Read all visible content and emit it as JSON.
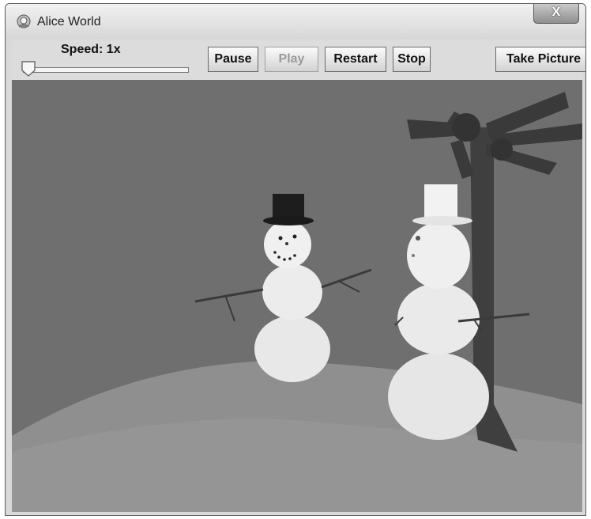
{
  "window": {
    "title": "Alice World",
    "close_symbol": "X"
  },
  "toolbar": {
    "speed_label": "Speed: 1x",
    "speed_slider": {
      "value": 1,
      "position_fraction": 0.0
    },
    "buttons": {
      "pause": "Pause",
      "play": "Play",
      "restart": "Restart",
      "stop": "Stop",
      "take_picture": "Take Picture"
    }
  },
  "scene": {
    "description": "",
    "icons": [
      "alice-app-icon",
      "slider-thumb-icon"
    ]
  },
  "colors": {
    "titlebar_top": "#f2f2f2",
    "titlebar_bottom": "#d6d6d6",
    "toolbar_bg": "#dcdcdc",
    "sky": "#6e6e6e",
    "ground": "#8d8d8d",
    "tree": "#3e3e3e",
    "snow": "#e6e6e6",
    "disabled_text": "#9a9a9a"
  }
}
